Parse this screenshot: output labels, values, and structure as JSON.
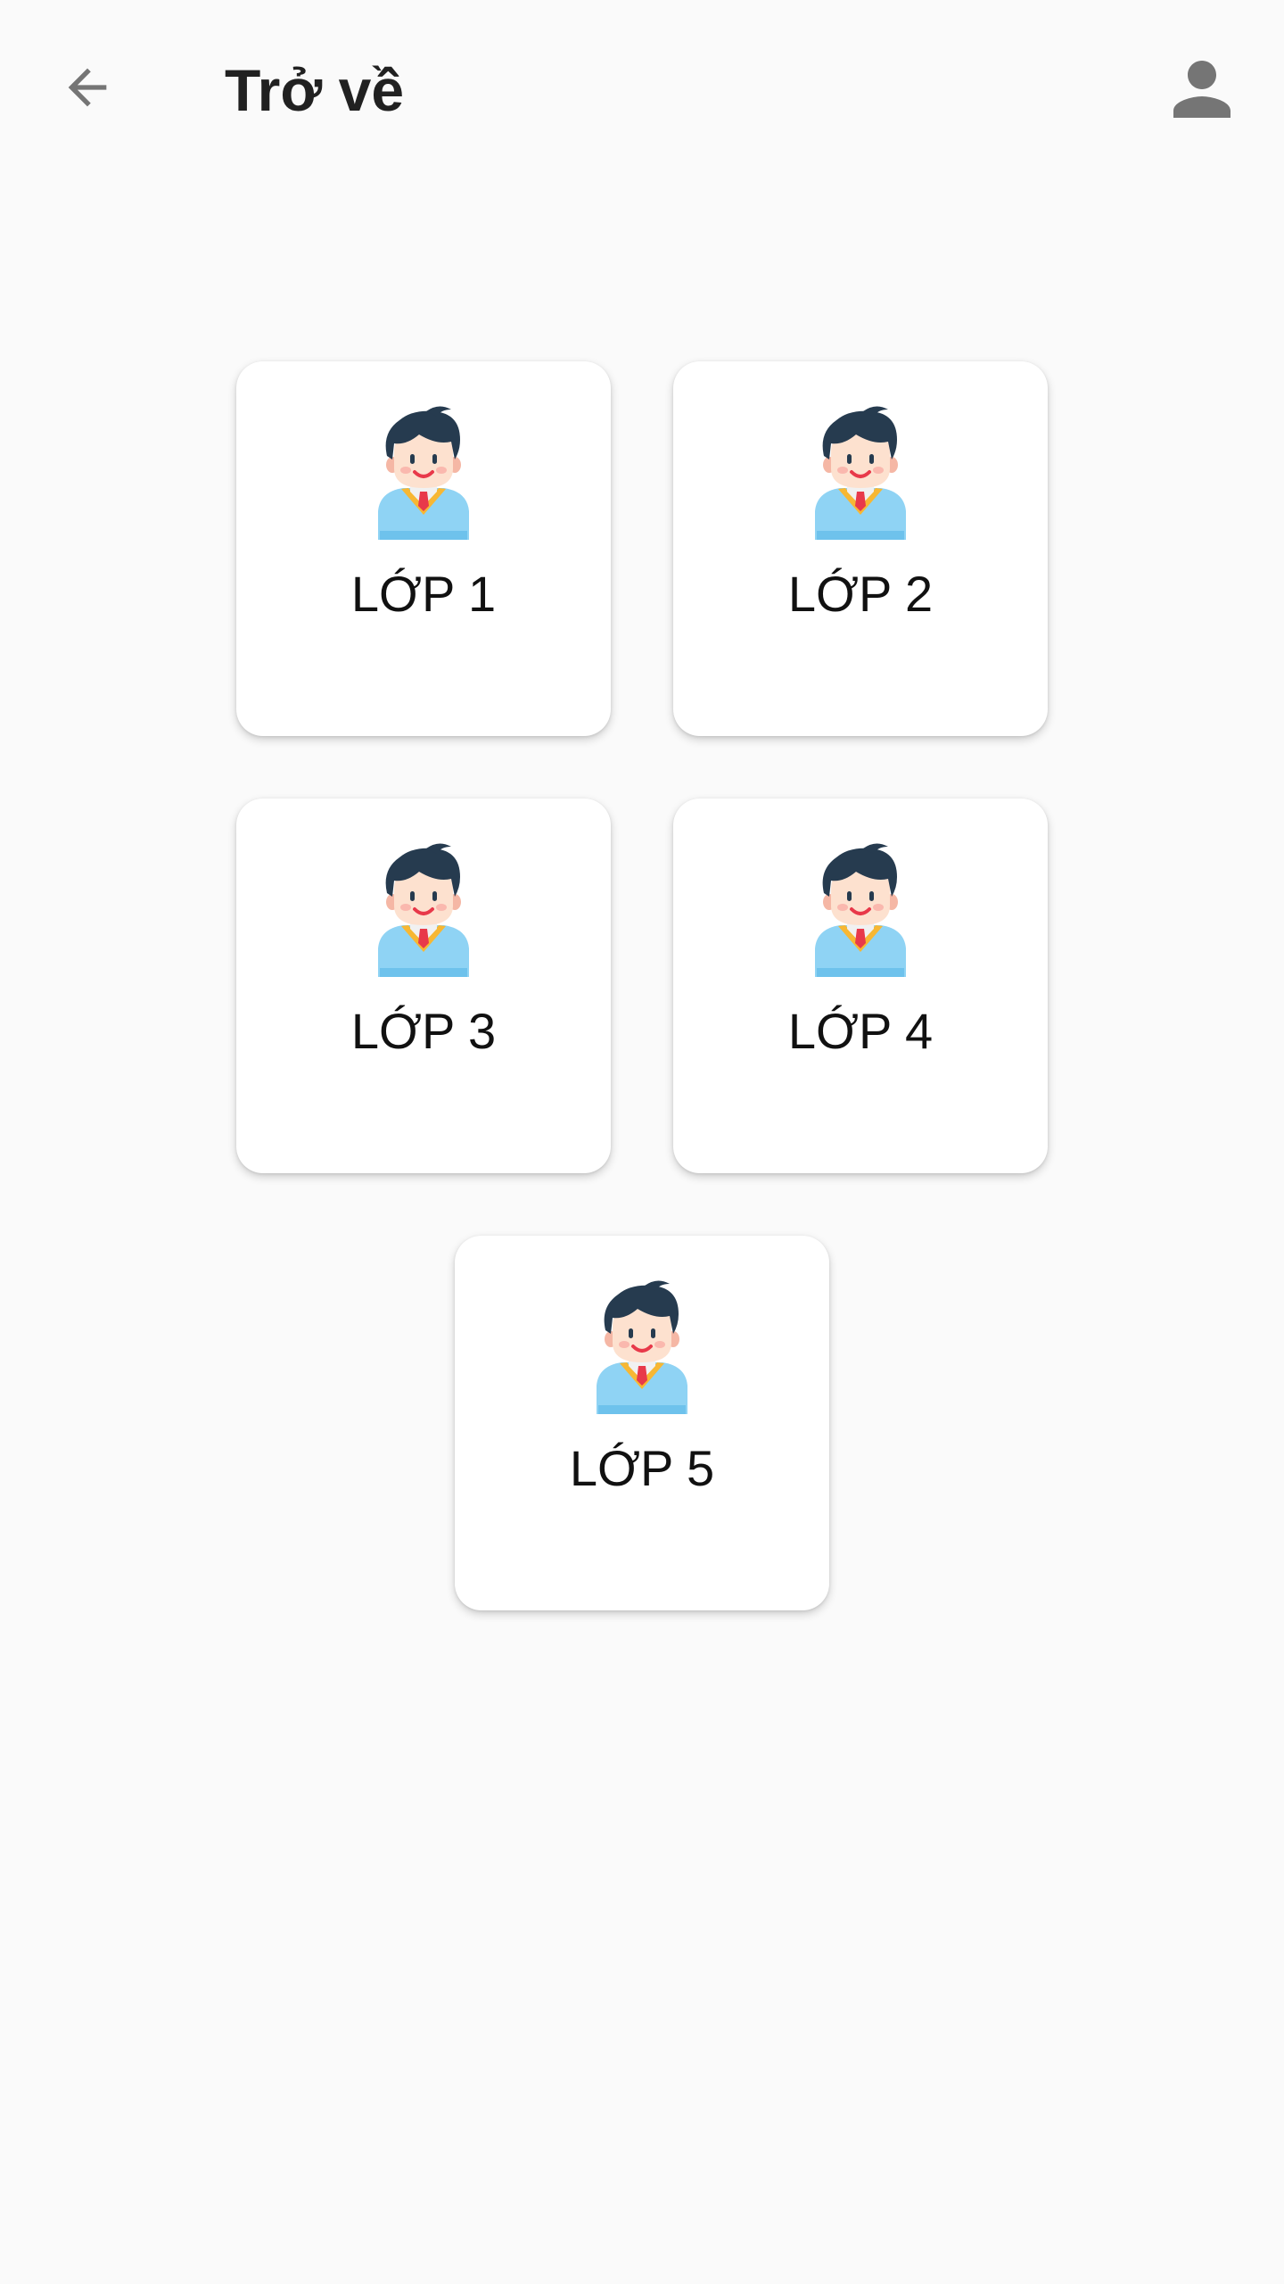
{
  "header": {
    "back_icon": "arrow-left-icon",
    "title": "Trở về",
    "profile_icon": "person-icon"
  },
  "colors": {
    "background": "#fafafa",
    "card": "#ffffff",
    "icon": "#757575",
    "title": "#212121"
  },
  "classes": [
    {
      "label": "LỚP 1",
      "icon": "student-avatar-icon"
    },
    {
      "label": "LỚP 2",
      "icon": "student-avatar-icon"
    },
    {
      "label": "LỚP 3",
      "icon": "student-avatar-icon"
    },
    {
      "label": "LỚP 4",
      "icon": "student-avatar-icon"
    },
    {
      "label": "LỚP 5",
      "icon": "student-avatar-icon"
    }
  ]
}
